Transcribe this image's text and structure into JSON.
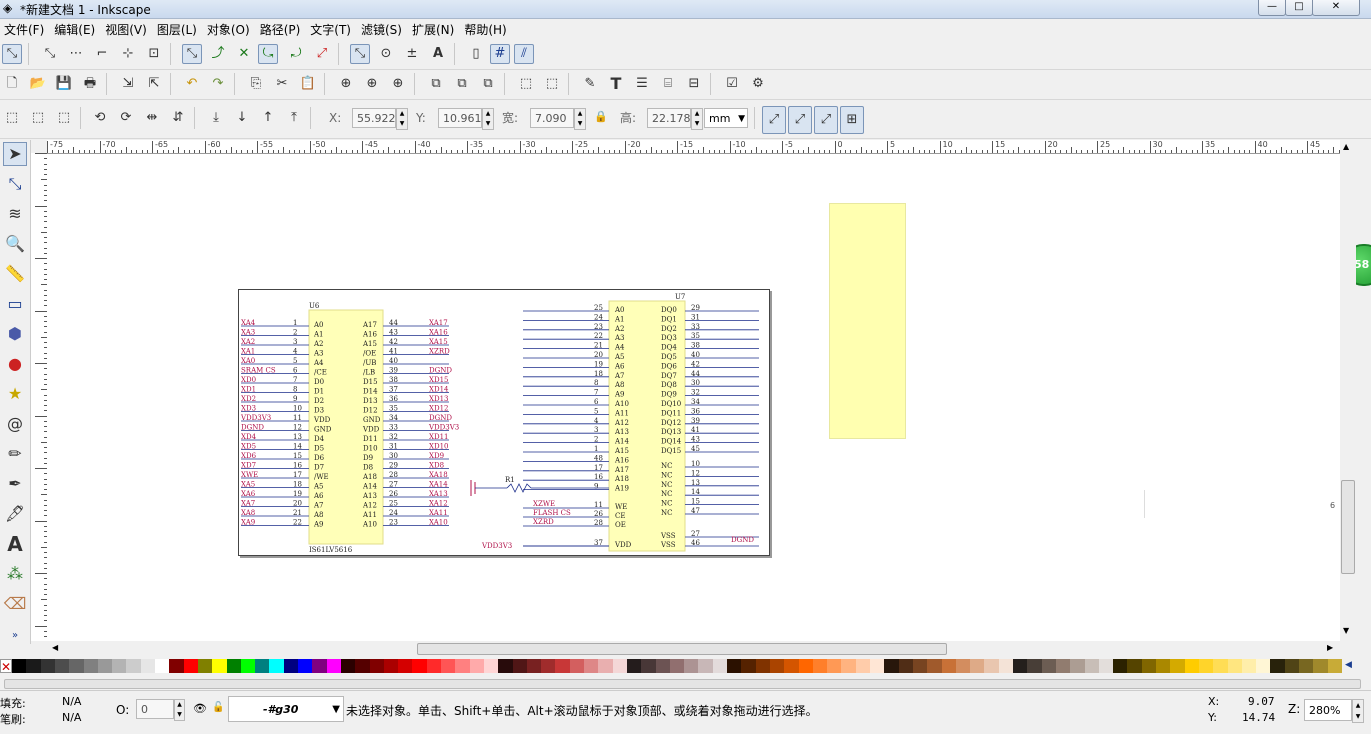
{
  "window": {
    "title": "*新建文档 1 - Inkscape",
    "minimize": "—",
    "maximize": "□",
    "close": "✕"
  },
  "menu": [
    "文件(F)",
    "编辑(E)",
    "视图(V)",
    "图层(L)",
    "对象(O)",
    "路径(P)",
    "文字(T)",
    "滤镜(S)",
    "扩展(N)",
    "帮助(H)"
  ],
  "toolbar3": {
    "x_label": "X:",
    "x_value": "55.922",
    "y_label": "Y:",
    "y_value": "10.961",
    "w_label": "宽:",
    "w_value": "7.090",
    "h_label": "高:",
    "h_value": "22.178",
    "unit": "mm"
  },
  "ruler_labels": [
    "-75",
    "-70",
    "-65",
    "-60",
    "-55",
    "-50",
    "-45",
    "-40",
    "-35",
    "-30",
    "-25",
    "-20",
    "-15",
    "-10",
    "-5",
    "0",
    "5",
    "10",
    "15",
    "20",
    "25",
    "30",
    "35",
    "40",
    "45",
    "50",
    "55",
    "60",
    "65",
    "70",
    "75",
    "80",
    "85",
    "90",
    "95",
    "100"
  ],
  "canvas": {
    "edge_number": "6",
    "badge": "58"
  },
  "schematic": {
    "u6": {
      "ref": "U6",
      "part": "IS61LV5616",
      "left_nets": [
        "XA4",
        "XA3",
        "XA2",
        "XA1",
        "XA0",
        "SRAM CS",
        "XD0",
        "XD1",
        "XD2",
        "XD3",
        "VDD3V3",
        "DGND",
        "XD4",
        "XD5",
        "XD6",
        "XD7",
        "XWE",
        "XA5",
        "XA6",
        "XA7",
        "XA8",
        "XA9"
      ],
      "left_pins": [
        "1",
        "2",
        "3",
        "4",
        "5",
        "6",
        "7",
        "8",
        "9",
        "10",
        "11",
        "12",
        "13",
        "14",
        "15",
        "16",
        "17",
        "18",
        "19",
        "20",
        "21",
        "22"
      ],
      "left_names": [
        "A0",
        "A1",
        "A2",
        "A3",
        "A4",
        "/CE",
        "D0",
        "D1",
        "D2",
        "D3",
        "VDD",
        "GND",
        "D4",
        "D5",
        "D6",
        "D7",
        "/WE",
        "A5",
        "A6",
        "A7",
        "A8",
        "A9"
      ],
      "right_names": [
        "A17",
        "A16",
        "A15",
        "/OE",
        "/UB",
        "/LB",
        "D15",
        "D14",
        "D13",
        "D12",
        "GND",
        "VDD",
        "D11",
        "D10",
        "D9",
        "D8",
        "A18",
        "A14",
        "A13",
        "A12",
        "A11",
        "A10"
      ],
      "right_pins": [
        "44",
        "43",
        "42",
        "41",
        "40",
        "39",
        "38",
        "37",
        "36",
        "35",
        "34",
        "33",
        "32",
        "31",
        "30",
        "29",
        "28",
        "27",
        "26",
        "25",
        "24",
        "23"
      ],
      "right_nets": [
        "XA17",
        "XA16",
        "XA15",
        "XZRD",
        "",
        "DGND",
        "XD15",
        "XD14",
        "XD13",
        "XD12",
        "DGND",
        "VDD3V3",
        "XD11",
        "XD10",
        "XD9",
        "XD8",
        "XA18",
        "XA14",
        "XA13",
        "XA12",
        "XA11",
        "XA10"
      ]
    },
    "u7": {
      "ref": "U7",
      "left_pins": [
        "25",
        "24",
        "23",
        "22",
        "21",
        "20",
        "19",
        "18",
        "8",
        "7",
        "6",
        "5",
        "4",
        "3",
        "2",
        "1",
        "48",
        "17",
        "16",
        "9",
        "",
        "11",
        "26",
        "28",
        "",
        "37"
      ],
      "left_names": [
        "A0",
        "A1",
        "A2",
        "A3",
        "A4",
        "A5",
        "A6",
        "A7",
        "A8",
        "A9",
        "A10",
        "A11",
        "A12",
        "A13",
        "A14",
        "A15",
        "A16",
        "A17",
        "A18",
        "A19",
        "",
        "WE",
        "CE",
        "OE",
        "",
        "VDD"
      ],
      "right_names": [
        "DQ0",
        "DQ1",
        "DQ2",
        "DQ3",
        "DQ4",
        "DQ5",
        "DQ6",
        "DQ7",
        "DQ8",
        "DQ9",
        "DQ10",
        "DQ11",
        "DQ12",
        "DQ13",
        "DQ14",
        "DQ15",
        "",
        "NC",
        "NC",
        "NC",
        "NC",
        "NC",
        "NC",
        "",
        "VSS",
        "VSS"
      ],
      "right_pins": [
        "29",
        "31",
        "33",
        "35",
        "38",
        "40",
        "42",
        "44",
        "30",
        "32",
        "34",
        "36",
        "39",
        "41",
        "43",
        "45",
        "",
        "10",
        "12",
        "13",
        "14",
        "15",
        "47",
        "",
        "27",
        "46"
      ],
      "ctl_nets": [
        "XZWE",
        "FLASH CS",
        "XZRD"
      ],
      "power_left": "VDD3V3",
      "power_right": "DGND",
      "res_ref": "R1"
    }
  },
  "palette": [
    "#000000",
    "#1a1a1a",
    "#333333",
    "#4d4d4d",
    "#666666",
    "#808080",
    "#999999",
    "#b3b3b3",
    "#cccccc",
    "#e6e6e6",
    "#ffffff",
    "#800000",
    "#ff0000",
    "#808000",
    "#ffff00",
    "#008000",
    "#00ff00",
    "#008080",
    "#00ffff",
    "#000080",
    "#0000ff",
    "#800080",
    "#ff00ff",
    "#2b0000",
    "#550000",
    "#800000",
    "#aa0000",
    "#d40000",
    "#ff0000",
    "#ff2a2a",
    "#ff5555",
    "#ff8080",
    "#ffaaaa",
    "#ffd5d5",
    "#280b0b",
    "#501616",
    "#782121",
    "#a02c2c",
    "#c83737",
    "#d35f5f",
    "#de8787",
    "#e9afaf",
    "#f4d7d7",
    "#241c1c",
    "#483737",
    "#6c5353",
    "#916f6f",
    "#ac9393",
    "#c8b7b7",
    "#e3dbdb",
    "#2b1100",
    "#552200",
    "#803300",
    "#aa4400",
    "#d45500",
    "#ff6600",
    "#ff7f2a",
    "#ff9955",
    "#ffb380",
    "#ffccaa",
    "#ffe6d5",
    "#28170b",
    "#502d16",
    "#784421",
    "#a05a2c",
    "#c87137",
    "#d38d5f",
    "#deaa87",
    "#e9c6af",
    "#f4e3d7",
    "#241f1c",
    "#483e37",
    "#6c5d53",
    "#917c6f",
    "#ac9d93",
    "#c8beb7",
    "#e3dedb",
    "#2b2200",
    "#554400",
    "#806600",
    "#aa8800",
    "#d4aa00",
    "#ffcc00",
    "#ffd42a",
    "#ffdd55",
    "#ffe680",
    "#ffeeaa",
    "#fff6d5",
    "#28220b",
    "#504416",
    "#786721",
    "#a0892c",
    "#c8ab37"
  ],
  "status": {
    "fill_label": "填充:",
    "fill_value": "N/A",
    "stroke_label": "笔刷:",
    "stroke_value": "N/A",
    "opacity_label": "O:",
    "opacity_value": "0",
    "layer": "-#g30",
    "message": "未选择对象。单击、Shift+单击、Alt+滚动鼠标于对象顶部、或绕着对象拖动进行选择。",
    "x_label": "X:",
    "x_value": "9.07",
    "y_label": "Y:",
    "y_value": "14.74",
    "z_label": "Z:",
    "zoom": "280%"
  }
}
